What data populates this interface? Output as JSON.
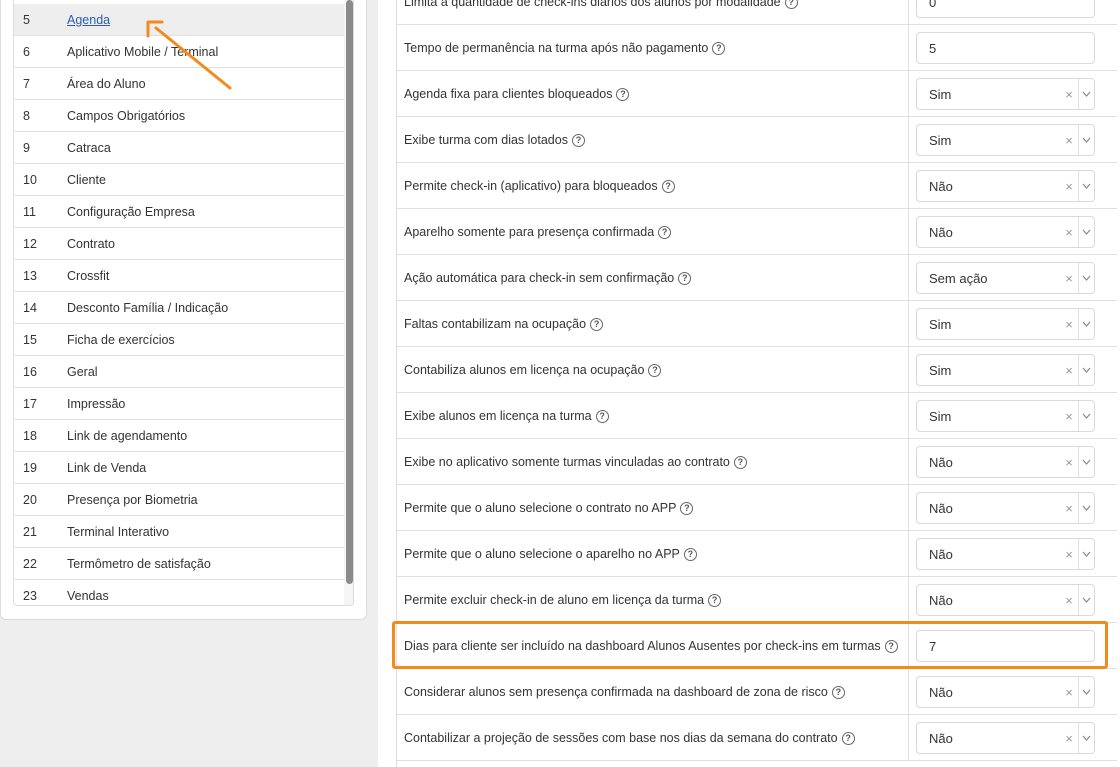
{
  "sidebar": {
    "items": [
      {
        "num": "5",
        "label": "Agenda"
      },
      {
        "num": "6",
        "label": "Aplicativo Mobile / Terminal"
      },
      {
        "num": "7",
        "label": "Área do Aluno"
      },
      {
        "num": "8",
        "label": "Campos Obrigatórios"
      },
      {
        "num": "9",
        "label": "Catraca"
      },
      {
        "num": "10",
        "label": "Cliente"
      },
      {
        "num": "11",
        "label": "Configuração Empresa"
      },
      {
        "num": "12",
        "label": "Contrato"
      },
      {
        "num": "13",
        "label": "Crossfit"
      },
      {
        "num": "14",
        "label": "Desconto Família / Indicação"
      },
      {
        "num": "15",
        "label": "Ficha de exercícios"
      },
      {
        "num": "16",
        "label": "Geral"
      },
      {
        "num": "17",
        "label": "Impressão"
      },
      {
        "num": "18",
        "label": "Link de agendamento"
      },
      {
        "num": "19",
        "label": "Link de Venda"
      },
      {
        "num": "20",
        "label": "Presença por Biometria"
      },
      {
        "num": "21",
        "label": "Terminal Interativo"
      },
      {
        "num": "22",
        "label": "Termômetro de satisfação"
      },
      {
        "num": "23",
        "label": "Vendas"
      }
    ]
  },
  "settings": {
    "rows": [
      {
        "label": "Limita a quantidade de check-ins diários dos alunos por modalidade",
        "value": "0",
        "type": "input"
      },
      {
        "label": "Tempo de permanência na turma após não pagamento",
        "value": "5",
        "type": "input"
      },
      {
        "label": "Agenda fixa para clientes bloqueados",
        "value": "Sim",
        "type": "select"
      },
      {
        "label": "Exibe turma com dias lotados",
        "value": "Sim",
        "type": "select"
      },
      {
        "label": "Permite check-in (aplicativo) para bloqueados",
        "value": "Não",
        "type": "select"
      },
      {
        "label": "Aparelho somente para presença confirmada",
        "value": "Não",
        "type": "select"
      },
      {
        "label": "Ação automática para check-in sem confirmação",
        "value": "Sem ação",
        "type": "select"
      },
      {
        "label": "Faltas contabilizam na ocupação",
        "value": "Sim",
        "type": "select"
      },
      {
        "label": "Contabiliza alunos em licença na ocupação",
        "value": "Sim",
        "type": "select"
      },
      {
        "label": "Exibe alunos em licença na turma",
        "value": "Sim",
        "type": "select"
      },
      {
        "label": "Exibe no aplicativo somente turmas vinculadas ao contrato",
        "value": "Não",
        "type": "select"
      },
      {
        "label": "Permite que o aluno selecione o contrato no APP",
        "value": "Não",
        "type": "select"
      },
      {
        "label": "Permite que o aluno selecione o aparelho no APP",
        "value": "Não",
        "type": "select"
      },
      {
        "label": "Permite excluir check-in de aluno em licença da turma",
        "value": "Não",
        "type": "select"
      },
      {
        "label": "Dias para cliente ser incluído na dashboard Alunos Ausentes por check-ins em turmas",
        "value": "7",
        "type": "input"
      },
      {
        "label": "Considerar alunos sem presença confirmada na dashboard de zona de risco",
        "value": "Não",
        "type": "select"
      },
      {
        "label": "Contabilizar a projeção de sessões com base nos dias da semana do contrato",
        "value": "Não",
        "type": "select"
      }
    ]
  },
  "icons": {
    "help": "?",
    "clear": "×"
  },
  "colors": {
    "highlight": "#f28b1b",
    "link": "#2a5db0",
    "active_row": "#eeeeee"
  }
}
